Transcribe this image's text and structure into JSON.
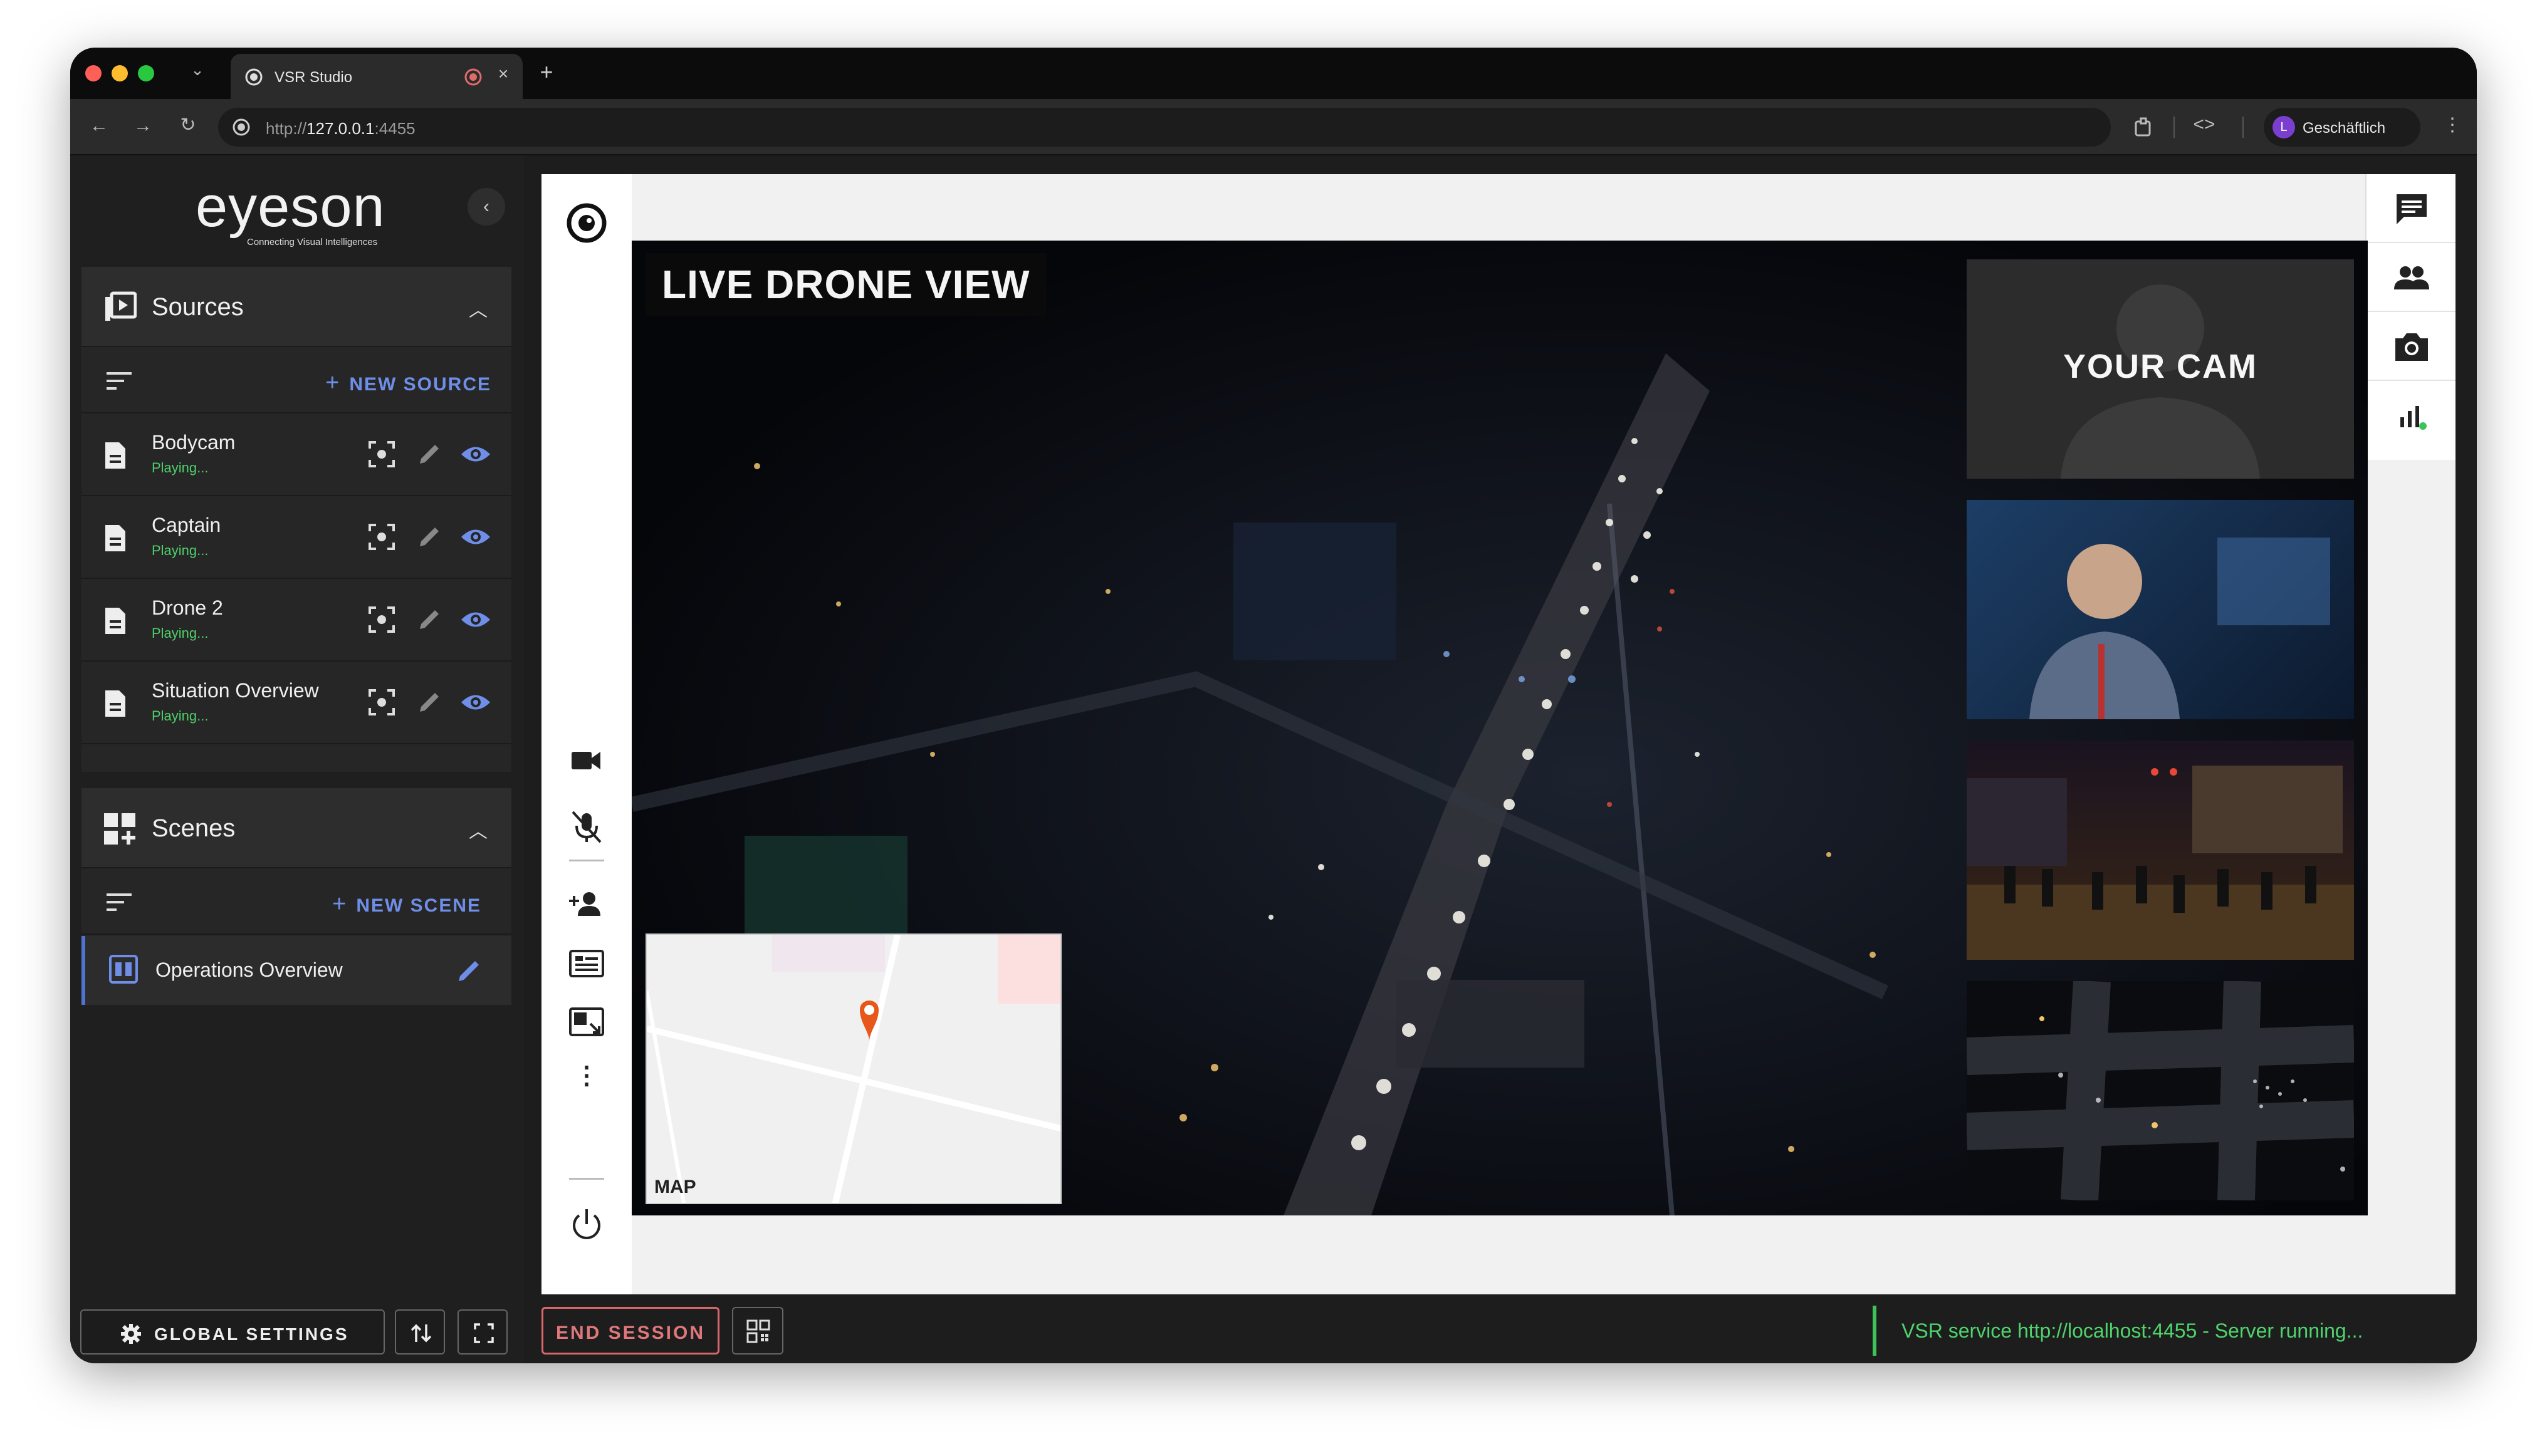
{
  "browser": {
    "tab_title": "VSR Studio",
    "url_prefix": "http://",
    "url_host": "127.0.0.1",
    "url_port": ":4455",
    "profile_initial": "L",
    "profile_name": "Geschäftlich"
  },
  "sidebar": {
    "logo_text": "eyeson",
    "logo_tagline": "Connecting Visual Intelligences",
    "sources": {
      "title": "Sources",
      "new_label": "NEW SOURCE",
      "items": [
        {
          "name": "Bodycam",
          "status": "Playing..."
        },
        {
          "name": "Captain",
          "status": "Playing..."
        },
        {
          "name": "Drone 2",
          "status": "Playing..."
        },
        {
          "name": "Situation Overview",
          "status": "Playing..."
        }
      ]
    },
    "scenes": {
      "title": "Scenes",
      "new_label": "NEW SCENE",
      "items": [
        {
          "name": "Operations Overview"
        }
      ]
    },
    "global_settings_label": "GLOBAL SETTINGS"
  },
  "stage": {
    "main_label": "LIVE DRONE VIEW",
    "map_label": "MAP",
    "cam_label": "YOUR CAM"
  },
  "bottom": {
    "end_session_label": "END SESSION",
    "status_text": "VSR service http://localhost:4455 - Server running..."
  },
  "colors": {
    "accent_blue": "#6f8ee8",
    "status_green": "#4fd46c",
    "end_red": "#e0787b"
  }
}
